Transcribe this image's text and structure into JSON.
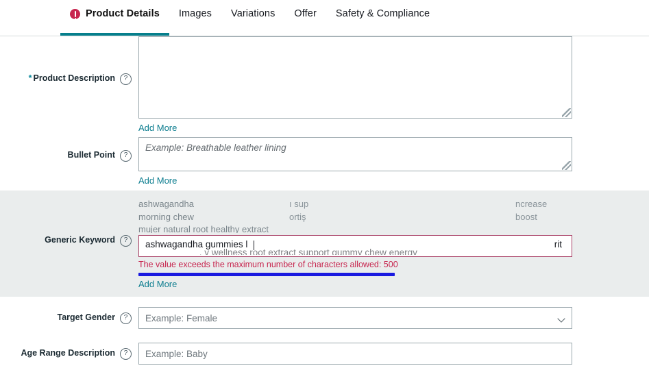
{
  "tabs": [
    {
      "label": "Product Details",
      "active": true,
      "has_error": true
    },
    {
      "label": "Images",
      "active": false,
      "has_error": false
    },
    {
      "label": "Variations",
      "active": false,
      "has_error": false
    },
    {
      "label": "Offer",
      "active": false,
      "has_error": false
    },
    {
      "label": "Safety & Compliance",
      "active": false,
      "has_error": false
    }
  ],
  "colors": {
    "tab_underline": "#067f8c",
    "error_badge": "#c7254e",
    "error_text": "#c7254e",
    "error_border": "#a94167",
    "link": "#0c7d8f",
    "required_star": "#0d8a9c",
    "row_highlight": "#eaeded",
    "blue_bar": "#1a1ae0"
  },
  "fields": {
    "product_description": {
      "label": "Product Description",
      "required": true,
      "required_marker": "*",
      "help_icon": "question-mark-circle-icon",
      "value": "",
      "placeholder": "",
      "add_more_label": "Add More"
    },
    "bullet_point": {
      "label": "Bullet Point",
      "required": false,
      "help_icon": "question-mark-circle-icon",
      "value": "",
      "placeholder": "Example: Breathable leather lining",
      "add_more_label": "Add More"
    },
    "generic_keyword": {
      "label": "Generic Keyword",
      "required": false,
      "help_icon": "question-mark-circle-icon",
      "overflow_lines": [
        {
          "col1": "ashwagandha",
          "col2": "ı sup",
          "col3": "ncrease"
        },
        {
          "col1": "morning chew",
          "col2": "ortiş",
          "col3": "boost"
        },
        {
          "col1": "mujer natural root healthy extract",
          "col2": "",
          "col3": ""
        }
      ],
      "value": "ashwagandha gummies l",
      "value_tail": "rit",
      "error_message": "The value exceeds the maximum number of characters allowed: 500",
      "max_characters": "500",
      "add_more_label": "Add More"
    },
    "target_gender": {
      "label": "Target Gender",
      "help_icon": "question-mark-circle-icon",
      "value": "",
      "placeholder": "Example: Female",
      "dropdown_icon": "chevron-down-icon"
    },
    "age_range_description": {
      "label": "Age Range Description",
      "help_icon": "question-mark-circle-icon",
      "value": "",
      "placeholder": "Example: Baby"
    }
  }
}
